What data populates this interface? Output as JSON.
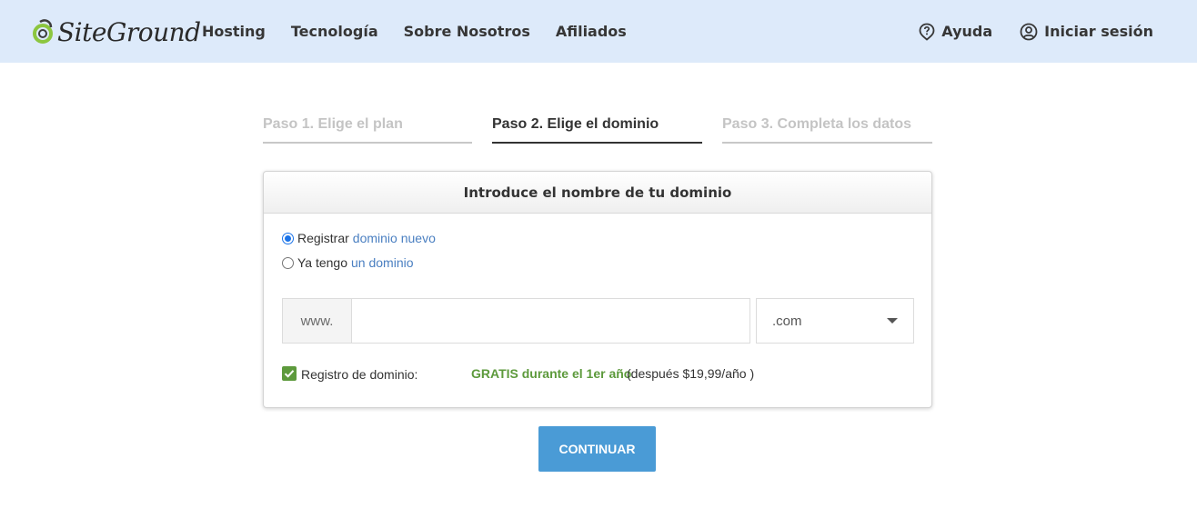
{
  "header": {
    "logo_text": "SiteGround",
    "nav": [
      "Hosting",
      "Tecnología",
      "Sobre Nosotros",
      "Afiliados"
    ],
    "help_label": "Ayuda",
    "login_label": "Iniciar sesión"
  },
  "steps": [
    {
      "label": "Paso 1. Elige el plan",
      "state": "inactive"
    },
    {
      "label": "Paso 2. Elige el dominio",
      "state": "active"
    },
    {
      "label": "Paso 3. Completa los datos",
      "state": "inactive"
    }
  ],
  "card": {
    "title": "Introduce el nombre de tu dominio",
    "option_register": {
      "prefix": "Registrar",
      "link": "dominio nuevo",
      "checked": true
    },
    "option_existing": {
      "prefix": "Ya tengo",
      "link": "un dominio",
      "checked": false
    },
    "www_prefix": "www.",
    "domain_value": "",
    "domain_placeholder": "",
    "tld_selected": ".com",
    "registration_label": "Registro de dominio:",
    "registration_free": "GRATIS durante el 1er año",
    "registration_after": "(después $19,99/año )"
  },
  "continue_label": "CONTINUAR",
  "colors": {
    "header_bg": "#ddeafa",
    "accent_green": "#5d9a3c",
    "link_blue": "#4a7fc1",
    "button_blue": "#4a9bd6"
  }
}
